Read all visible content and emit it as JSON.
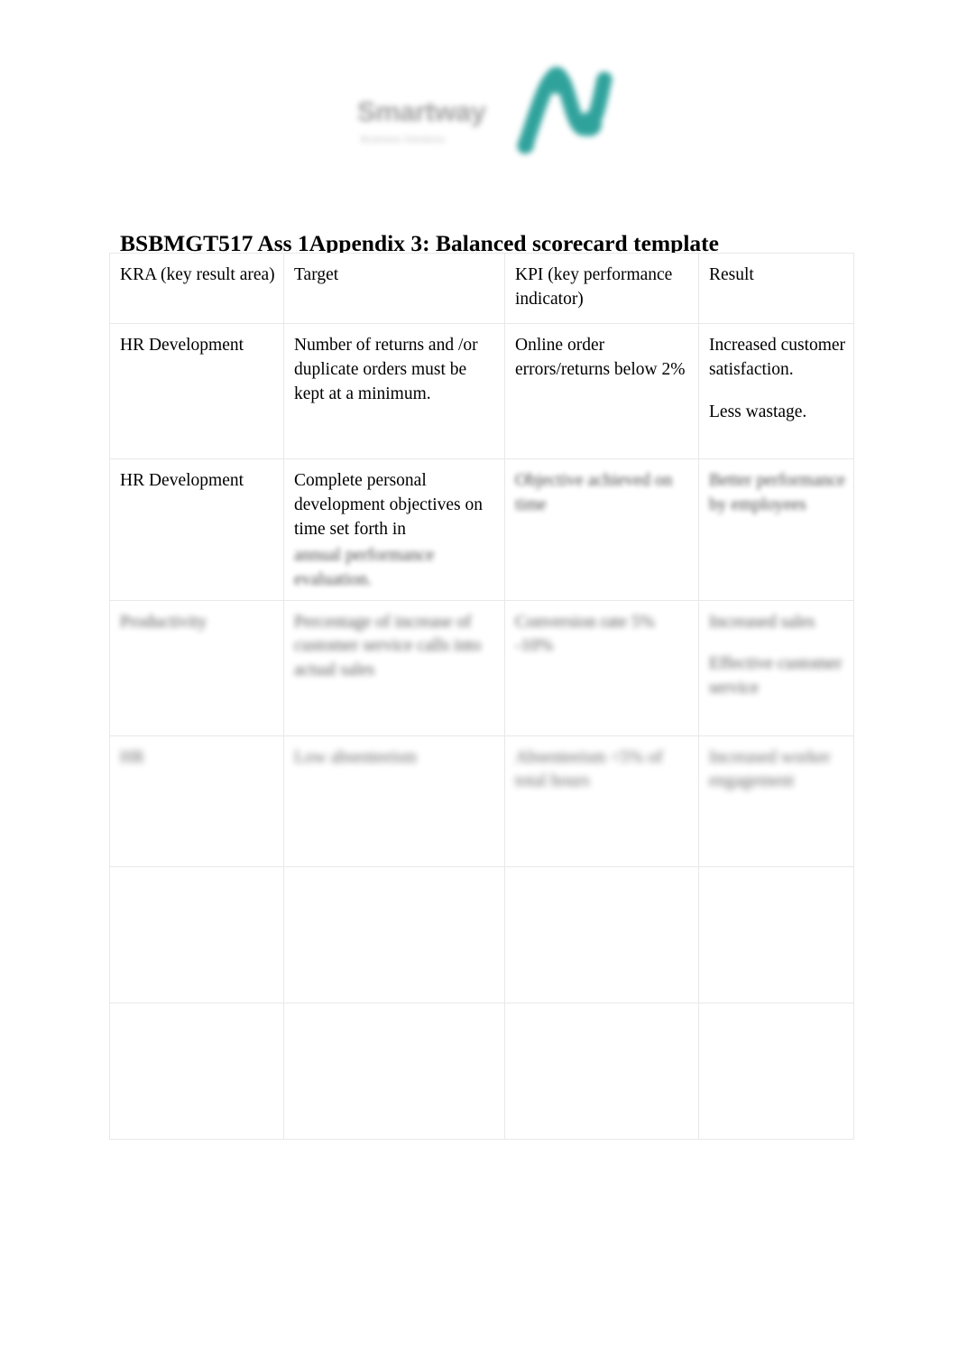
{
  "document": {
    "title": "BSBMGT517 Ass 1Appendix 3: Balanced scorecard template"
  },
  "logo": {
    "wordmark": "Smartway",
    "tagline": "Business Solutions",
    "mark_name": "teal-wave-checkmark",
    "accent_color": "#1f9b94",
    "wordmark_color": "#9b9b9b"
  },
  "table": {
    "headers": {
      "kra": "KRA (key result area)",
      "target": "Target",
      "kpi": "KPI (key performance indicator)",
      "result": "Result"
    },
    "rows": [
      {
        "kra": "HR Development",
        "target": "Number of returns and /or duplicate orders must be kept at a minimum.",
        "kpi": "Online order errors/returns below 2%",
        "result_1": "Increased customer satisfaction.",
        "result_2": "Less wastage.",
        "blur": "b0"
      },
      {
        "kra": "HR Development",
        "target_clear": "Complete personal development objectives on time set forth in",
        "target_blurred": "annual performance evaluation.",
        "kpi": "Objective achieved on time",
        "result": "Better performance by employees",
        "blur": "b1"
      },
      {
        "kra": "Productivity",
        "target": "Percentage of increase of customer service calls into actual sales",
        "kpi": "Conversion rate 5% -10%",
        "result_1": "Increased sales",
        "result_2": "Effective customer service",
        "blur": "b2"
      },
      {
        "kra": "HR",
        "target": "Low absenteeism",
        "kpi": "Absenteeism <5% of total hours",
        "result": "Increased worker engagement",
        "blur": "b3"
      },
      {
        "kra": "",
        "target": "",
        "kpi": "",
        "result": "",
        "blur": "b0"
      },
      {
        "kra": "",
        "target": "",
        "kpi": "",
        "result": "",
        "blur": "b0"
      }
    ]
  }
}
